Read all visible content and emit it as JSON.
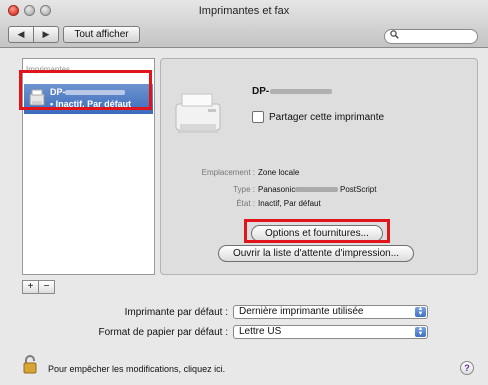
{
  "window": {
    "title": "Imprimantes et fax"
  },
  "toolbar": {
    "back": "◀",
    "forward": "▶",
    "show_all": "Tout afficher",
    "search_placeholder": ""
  },
  "list": {
    "header": "Imprimantes",
    "items": [
      {
        "name": "DP-",
        "status": "• Inactif, Par défaut"
      }
    ]
  },
  "details": {
    "name": "DP-",
    "share_label": "Partager cette imprimante",
    "share_checked": false,
    "location_label": "Emplacement :",
    "location_value": "Zone locale",
    "type_label": "Type :",
    "type_value_prefix": "Panasonic",
    "type_value_suffix": "PostScript",
    "state_label": "État :",
    "state_value": "Inactif, Par défaut",
    "options_button": "Options et fournitures...",
    "queue_button": "Ouvrir la liste d'attente d'impression..."
  },
  "list_controls": {
    "add": "+",
    "remove": "−"
  },
  "defaults": {
    "printer_label": "Imprimante par défaut :",
    "printer_value": "Dernière imprimante utilisée",
    "paper_label": "Format de papier par défaut :",
    "paper_value": "Lettre US"
  },
  "footer": {
    "lock_text": "Pour empêcher les modifications, cliquez ici.",
    "help": "?"
  },
  "colors": {
    "highlight": "#e0141b",
    "selection": "#3c6bbd"
  }
}
